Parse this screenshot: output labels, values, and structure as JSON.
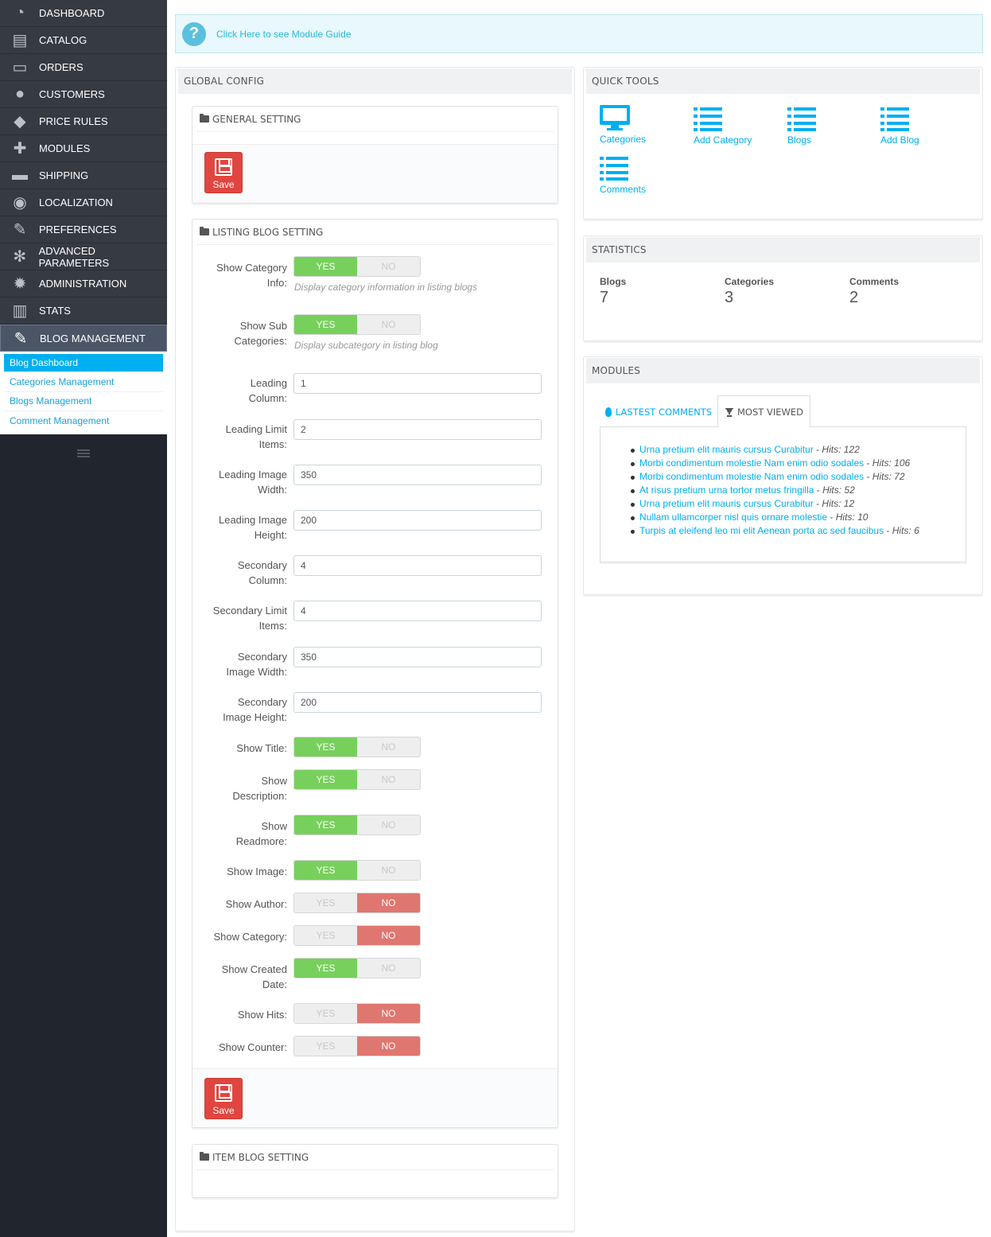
{
  "sidebar": {
    "items": [
      {
        "label": "DASHBOARD",
        "icon": "dashboard-icon"
      },
      {
        "label": "CATALOG",
        "icon": "book-icon"
      },
      {
        "label": "ORDERS",
        "icon": "credit-card-icon"
      },
      {
        "label": "CUSTOMERS",
        "icon": "users-icon"
      },
      {
        "label": "PRICE RULES",
        "icon": "tags-icon"
      },
      {
        "label": "MODULES",
        "icon": "puzzle-icon"
      },
      {
        "label": "SHIPPING",
        "icon": "truck-icon"
      },
      {
        "label": "LOCALIZATION",
        "icon": "globe-icon"
      },
      {
        "label": "PREFERENCES",
        "icon": "wrench-icon"
      },
      {
        "label": "ADVANCED PARAMETERS",
        "icon": "gears-icon"
      },
      {
        "label": "ADMINISTRATION",
        "icon": "gear-icon"
      },
      {
        "label": "STATS",
        "icon": "bar-chart-icon"
      },
      {
        "label": "BLOG MANAGEMENT",
        "icon": "pencil-icon"
      }
    ],
    "submenu": [
      "Blog Dashboard",
      "Categories Management",
      "Blogs Management",
      "Comment Management"
    ]
  },
  "guide": {
    "link": "Click Here to see Module Guide"
  },
  "global_config": {
    "title": "GLOBAL CONFIG",
    "general": {
      "title": "GENERAL SETTING",
      "save_label": "Save"
    },
    "listing": {
      "title": "LISTING BLOG SETTING",
      "save_label": "Save",
      "show_category_info": {
        "label_1": "Show Category",
        "label_2": "Info:",
        "help": "Display category information in listing blogs",
        "value": "YES"
      },
      "show_sub_categories": {
        "label_1": "Show Sub",
        "label_2": "Categories:",
        "help": "Display subcategory in listing blog",
        "value": "YES"
      },
      "leading_column": {
        "label_1": "Leading",
        "label_2": "Column:",
        "value": "1"
      },
      "leading_limit": {
        "label_1": "Leading Limit",
        "label_2": "Items:",
        "value": "2"
      },
      "leading_img_w": {
        "label_1": "Leading Image",
        "label_2": "Width:",
        "value": "350"
      },
      "leading_img_h": {
        "label_1": "Leading Image",
        "label_2": "Height:",
        "value": "200"
      },
      "secondary_column": {
        "label_1": "Secondary",
        "label_2": "Column:",
        "value": "4"
      },
      "secondary_limit": {
        "label_1": "Secondary Limit",
        "label_2": "Items:",
        "value": "4"
      },
      "secondary_img_w": {
        "label_1": "Secondary",
        "label_2": "Image Width:",
        "value": "350"
      },
      "secondary_img_h": {
        "label_1": "Secondary",
        "label_2": "Image Height:",
        "value": "200"
      },
      "show_title": {
        "label_1": "Show Title:",
        "value": "YES"
      },
      "show_description": {
        "label_1": "Show",
        "label_2": "Description:",
        "value": "YES"
      },
      "show_readmore": {
        "label_1": "Show",
        "label_2": "Readmore:",
        "value": "YES"
      },
      "show_image": {
        "label_1": "Show Image:",
        "value": "YES"
      },
      "show_author": {
        "label_1": "Show Author:",
        "value": "NO"
      },
      "show_category": {
        "label_1": "Show Category:",
        "value": "NO"
      },
      "show_created_date": {
        "label_1": "Show Created",
        "label_2": "Date:",
        "value": "YES"
      },
      "show_hits": {
        "label_1": "Show Hits:",
        "value": "NO"
      },
      "show_counter": {
        "label_1": "Show Counter:",
        "value": "NO"
      },
      "yes_label": "YES",
      "no_label": "NO"
    },
    "item": {
      "title": "ITEM BLOG SETTING"
    }
  },
  "quick_tools": {
    "title": "QUICK TOOLS",
    "items": [
      {
        "label": "Categories",
        "icon": "desktop-icon"
      },
      {
        "label": "Add Category",
        "icon": "list-icon"
      },
      {
        "label": "Blogs",
        "icon": "list-icon"
      },
      {
        "label": "Add Blog",
        "icon": "list-icon"
      },
      {
        "label": "Comments",
        "icon": "list-icon"
      }
    ]
  },
  "statistics": {
    "title": "STATISTICS",
    "items": [
      {
        "label": "Blogs",
        "value": "7"
      },
      {
        "label": "Categories",
        "value": "3"
      },
      {
        "label": "Comments",
        "value": "2"
      }
    ]
  },
  "modules": {
    "title": "MODULES",
    "tabs": [
      {
        "label": "LASTEST COMMENTS",
        "icon": "fire-icon"
      },
      {
        "label": "MOST VIEWED",
        "icon": "trophy-icon"
      }
    ],
    "hits_label": "Hits:",
    "most_viewed": [
      {
        "title": "Urna pretium elit mauris cursus Curabitur",
        "hits": "122"
      },
      {
        "title": "Morbi condimentum molestie Nam enim odio sodales",
        "hits": "106"
      },
      {
        "title": "Morbi condimentum molestie Nam enim odio sodales",
        "hits": "72"
      },
      {
        "title": "At risus pretium urna tortor metus fringilla",
        "hits": "52"
      },
      {
        "title": "Urna pretium elit mauris cursus Curabitur",
        "hits": "12"
      },
      {
        "title": "Nullam ullamcorper nisl quis ornare molestie",
        "hits": "10"
      },
      {
        "title": "Turpis at eleifend leo mi elit Aenean porta ac sed faucibus",
        "hits": "6"
      }
    ]
  },
  "colors": {
    "accent": "#00aff0",
    "yes_on": "#78d05c",
    "no_on": "#e07670",
    "save": "#e0463f",
    "sidebar": "#363a41"
  }
}
